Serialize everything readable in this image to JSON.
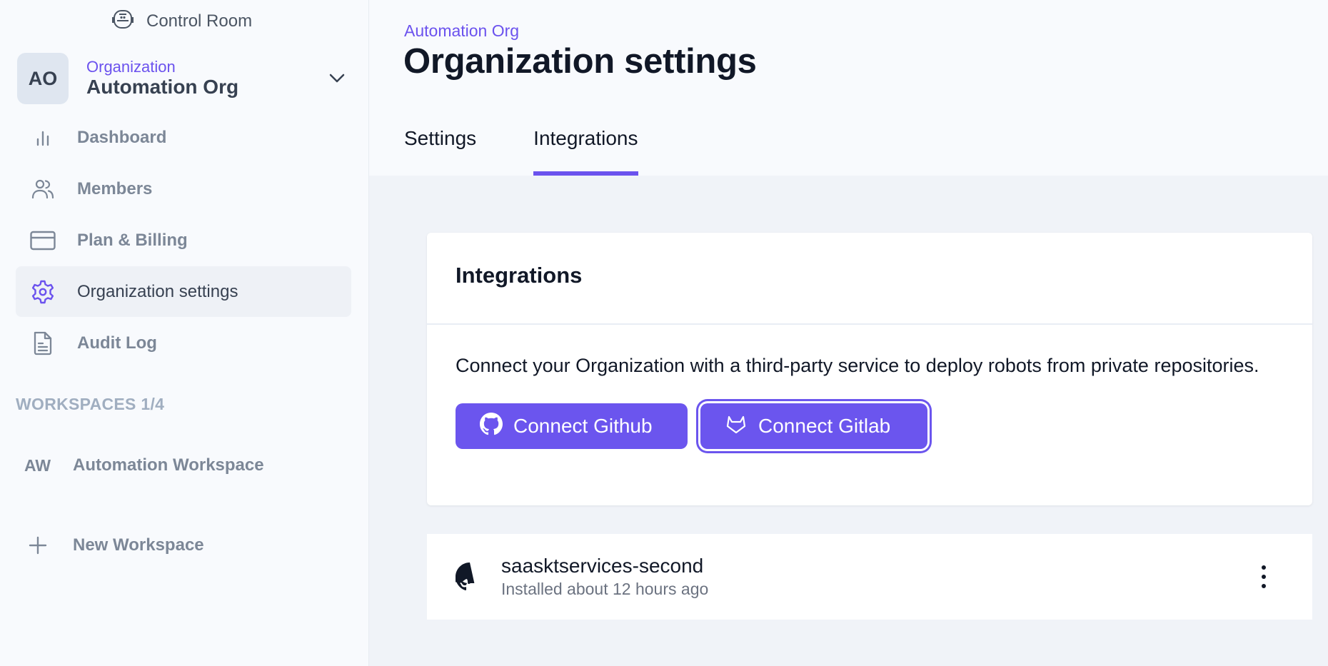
{
  "app": {
    "brand_name": "Control Room",
    "brand_icon": "robot-head-icon"
  },
  "org_switcher": {
    "avatar_initials": "AO",
    "label": "Organization",
    "name": "Automation Org",
    "chevron_icon": "chevron-down-icon"
  },
  "sidebar": {
    "items": [
      {
        "label": "Dashboard",
        "icon": "bar-chart-icon",
        "active": false
      },
      {
        "label": "Members",
        "icon": "users-icon",
        "active": false
      },
      {
        "label": "Plan & Billing",
        "icon": "credit-card-icon",
        "active": false
      },
      {
        "label": "Organization settings",
        "icon": "gear-icon",
        "active": true
      },
      {
        "label": "Audit Log",
        "icon": "document-icon",
        "active": false
      }
    ],
    "workspaces_header": "WORKSPACES 1/4",
    "workspaces": [
      {
        "abbr": "AW",
        "name": "Automation Workspace"
      }
    ],
    "new_workspace_label": "New Workspace"
  },
  "header": {
    "breadcrumb": "Automation Org",
    "title": "Organization settings",
    "tabs": [
      {
        "label": "Settings",
        "active": false
      },
      {
        "label": "Integrations",
        "active": true
      }
    ]
  },
  "integrations_card": {
    "title": "Integrations",
    "description": "Connect your Organization with a third-party service to deploy robots from private repositories.",
    "buttons": [
      {
        "label": "Connect Github",
        "icon": "github-icon"
      },
      {
        "label": "Connect Gitlab",
        "icon": "gitlab-icon",
        "focused": true
      }
    ]
  },
  "installations": [
    {
      "provider_icon": "github-icon",
      "name": "saasktservices-second",
      "status": "Installed about 12 hours ago"
    }
  ],
  "colors": {
    "accent": "#6b55ee",
    "text_primary": "#111827",
    "text_muted": "#7c8797",
    "page_bg": "#f0f3f8",
    "sidebar_bg": "#f8fafd"
  }
}
